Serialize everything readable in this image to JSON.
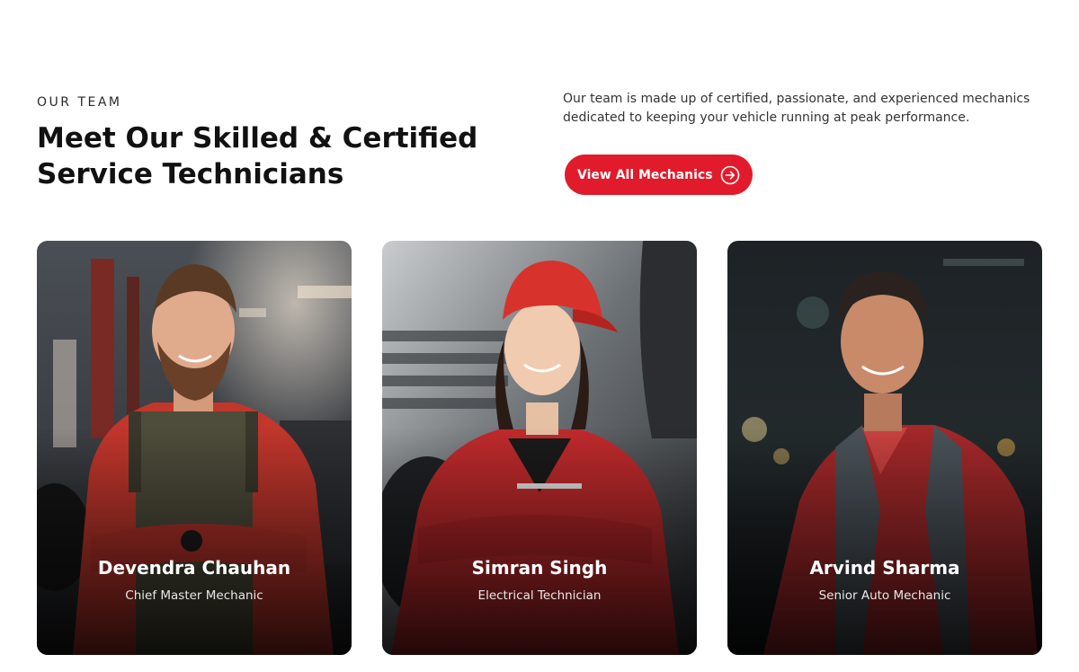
{
  "section": {
    "eyebrow": "OUR TEAM",
    "title_line1": "Meet Our Skilled & Certified",
    "title_line2": "Service Technicians",
    "description": "Our team is made up of certified, passionate, and experienced mechanics dedicated to keeping your vehicle running at peak performance.",
    "cta_label": "View All Mechanics",
    "cta_icon": "arrow-right-circle-icon"
  },
  "colors": {
    "accent": "#e11b2b",
    "heading": "#111111",
    "body_text": "#333333"
  },
  "team": [
    {
      "name": "Devendra Chauhan",
      "role": "Chief Master Mechanic"
    },
    {
      "name": "Simran Singh",
      "role": "Electrical Technician"
    },
    {
      "name": "Arvind Sharma",
      "role": "Senior Auto Mechanic"
    }
  ]
}
